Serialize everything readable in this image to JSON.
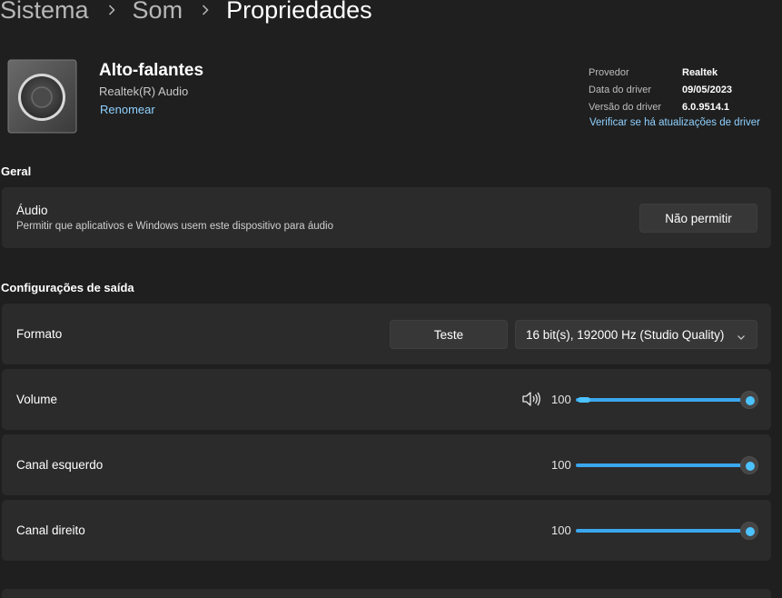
{
  "breadcrumb": {
    "items": [
      "Sistema",
      "Som",
      "Propriedades"
    ]
  },
  "device": {
    "name": "Alto-falantes",
    "driver_name": "Realtek(R) Audio",
    "rename_label": "Renomear",
    "icon": "speaker-icon"
  },
  "driver": {
    "rows": [
      {
        "label": "Provedor",
        "value": "Realtek"
      },
      {
        "label": "Data do driver",
        "value": "09/05/2023"
      },
      {
        "label": "Versão do driver",
        "value": "6.0.9514.1"
      }
    ],
    "update_link": "Verificar se há atualizações de driver"
  },
  "general": {
    "title": "Geral",
    "audio": {
      "label": "Áudio",
      "description": "Permitir que aplicativos e Windows usem este dispositivo para áudio",
      "button_label": "Não permitir"
    }
  },
  "output": {
    "title": "Configurações de saída",
    "format": {
      "label": "Formato",
      "test_label": "Teste",
      "selected": "16 bit(s), 192000 Hz (Studio Quality)"
    },
    "volume": {
      "label": "Volume",
      "value": "100",
      "level": 1.0
    },
    "left": {
      "label": "Canal esquerdo",
      "value": "100",
      "level": 1.0
    },
    "right": {
      "label": "Canal direito",
      "value": "100",
      "level": 1.0
    }
  },
  "colors": {
    "accent": "#4cc2ff",
    "link": "#8fd1ff",
    "background": "#1f1f1f",
    "card": "#2b2b2b"
  }
}
